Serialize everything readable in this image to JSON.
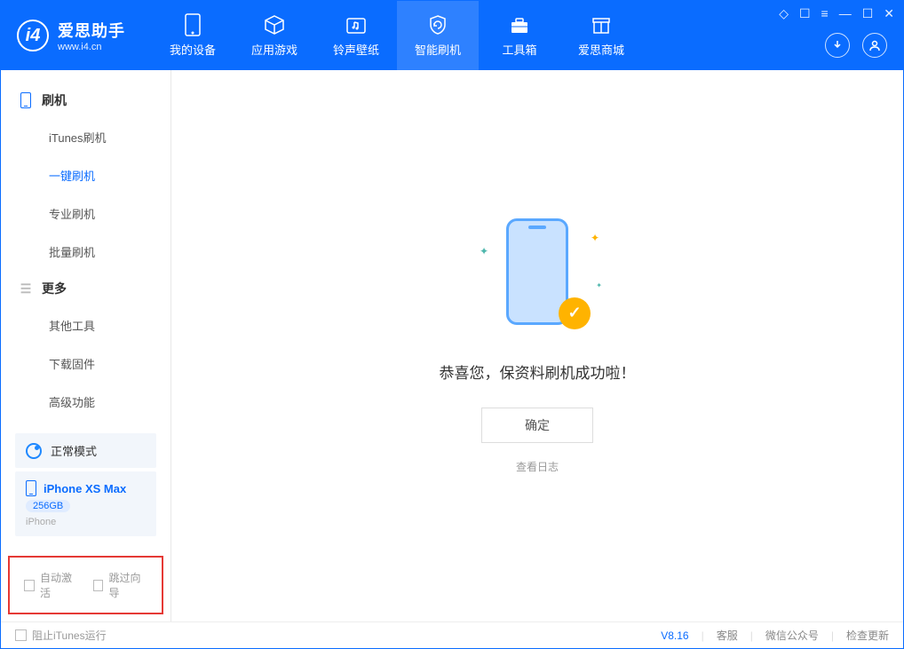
{
  "app": {
    "name_cn": "爱思助手",
    "url": "www.i4.cn"
  },
  "nav": [
    {
      "label": "我的设备"
    },
    {
      "label": "应用游戏"
    },
    {
      "label": "铃声壁纸"
    },
    {
      "label": "智能刷机"
    },
    {
      "label": "工具箱"
    },
    {
      "label": "爱思商城"
    }
  ],
  "sidebar": {
    "group1": "刷机",
    "items1": [
      "iTunes刷机",
      "一键刷机",
      "专业刷机",
      "批量刷机"
    ],
    "group2": "更多",
    "items2": [
      "其他工具",
      "下载固件",
      "高级功能"
    ]
  },
  "device": {
    "mode": "正常模式",
    "name": "iPhone XS Max",
    "capacity": "256GB",
    "type": "iPhone"
  },
  "checkboxes": {
    "auto_activate": "自动激活",
    "skip_guide": "跳过向导"
  },
  "main": {
    "success": "恭喜您，保资料刷机成功啦！",
    "ok": "确定",
    "view_log": "查看日志"
  },
  "footer": {
    "block_itunes": "阻止iTunes运行",
    "version": "V8.16",
    "service": "客服",
    "wechat": "微信公众号",
    "check_update": "检查更新"
  }
}
